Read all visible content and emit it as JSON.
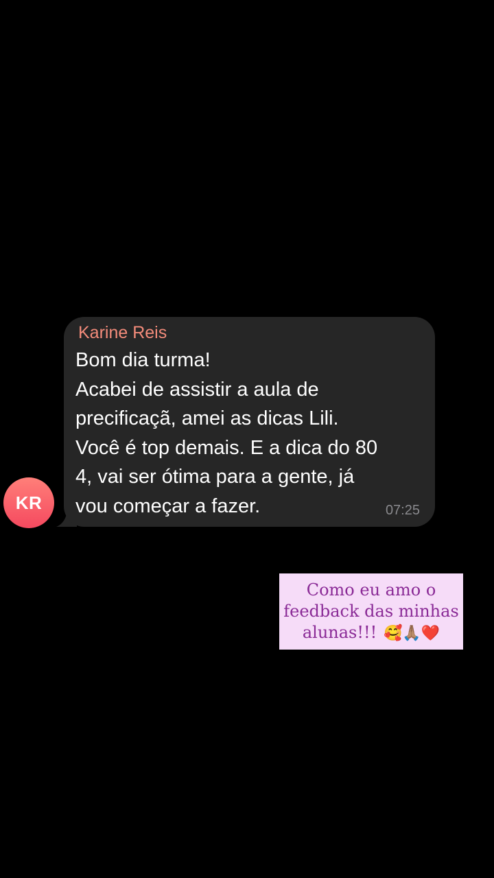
{
  "avatar": {
    "initials": "KR",
    "color_top": "#ff7f79",
    "color_bottom": "#f5495f"
  },
  "message": {
    "sender": "Karine Reis",
    "lines": [
      "Bom dia turma!",
      "Acabei de assistir a aula de",
      "precificaçã, amei as dicas Lili.",
      "Você é top demais. E a dica do 80",
      "4, vai ser ótima para a gente, já",
      "vou começar a fazer."
    ],
    "time": "07:25",
    "sender_color": "#f48c7b",
    "bubble_color": "#262626"
  },
  "sticker": {
    "lines": [
      "Como eu amo o",
      "feedback das minhas",
      "alunas!!!"
    ],
    "emojis": "🥰🙏🏽❤️",
    "background": "#f6dcf8",
    "text_color": "#8a2a96"
  }
}
